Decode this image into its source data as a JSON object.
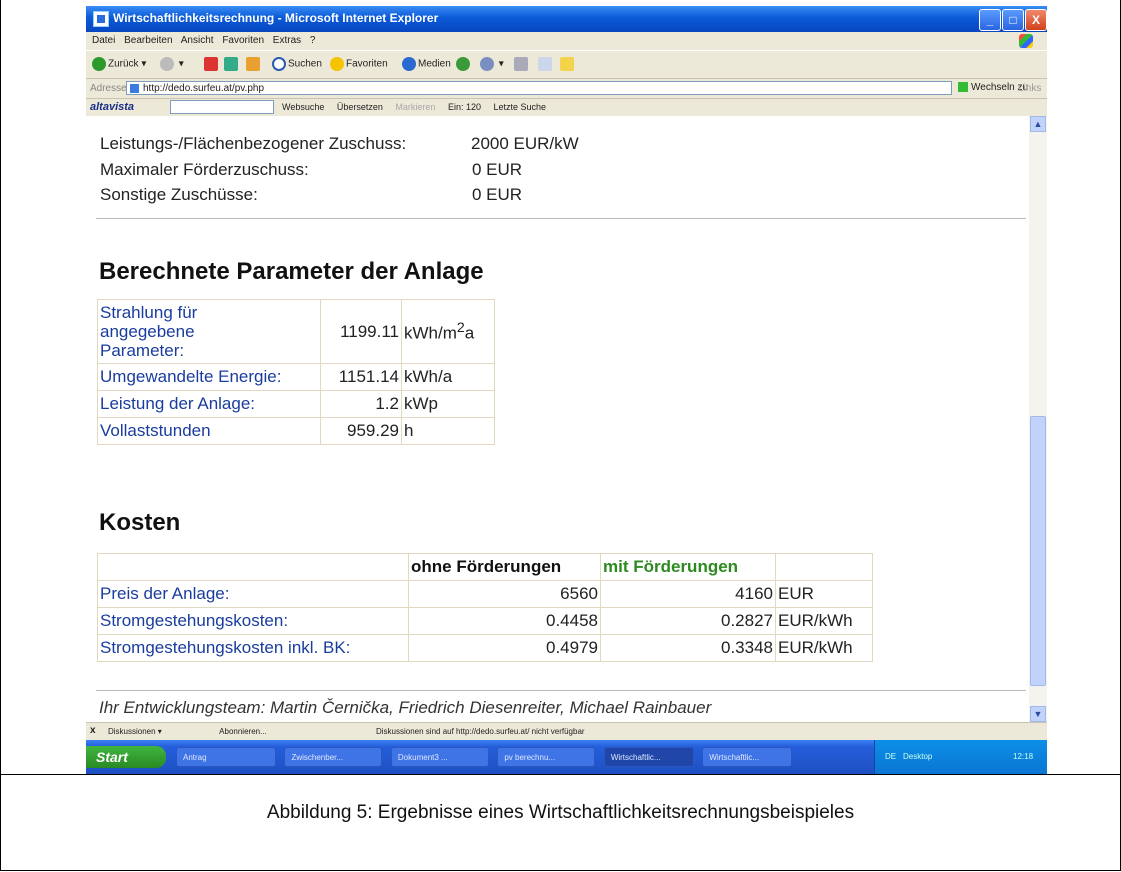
{
  "window": {
    "title": "Wirtschaftlichkeitsrechnung - Microsoft Internet Explorer",
    "min": "_",
    "max": "□",
    "close": "X"
  },
  "menu": [
    "Datei",
    "Bearbeiten",
    "Ansicht",
    "Favoriten",
    "Extras",
    "?"
  ],
  "toolbar": {
    "back": "Zurück",
    "search": "Suchen",
    "favorites": "Favoriten",
    "media": "Medien"
  },
  "address": {
    "label": "Adresse",
    "url": "http://dedo.surfeu.at/pv.php",
    "go": "Wechseln zu",
    "links": "Links"
  },
  "altavista": {
    "logo": "altavista",
    "items": [
      "Websuche",
      "Übersetzen",
      "Markieren",
      "Ein: 120",
      "Letzte Suche"
    ]
  },
  "subsidies": [
    {
      "label": "Leistungs-/Flächenbezogener Zuschuss:",
      "value": "2000 EUR/kW"
    },
    {
      "label": "Maximaler Förderzuschuss:",
      "value": "0 EUR"
    },
    {
      "label": "Sonstige Zuschüsse:",
      "value": "0 EUR"
    }
  ],
  "parameters": {
    "heading": "Berechnete Parameter der Anlage",
    "rows": [
      {
        "label_lines": [
          "Strahlung für",
          "angegebene",
          "Parameter:"
        ],
        "value": "1199.11",
        "unit_base": "kWh/m",
        "unit_sup": "2",
        "unit_tail": "a"
      },
      {
        "label": "Umgewandelte Energie:",
        "value": "1151.14",
        "unit": "kWh/a"
      },
      {
        "label": "Leistung der Anlage:",
        "value": "1.2",
        "unit": "kWp"
      },
      {
        "label": "Vollaststunden",
        "value": "959.29",
        "unit": "h"
      }
    ]
  },
  "costs": {
    "heading": "Kosten",
    "col_without": "ohne Förderungen",
    "col_with": "mit Förderungen",
    "rows": [
      {
        "label": "Preis der Anlage:",
        "without": "6560",
        "with": "4160",
        "unit": "EUR"
      },
      {
        "label": "Stromgestehungskosten:",
        "without": "0.4458",
        "with": "0.2827",
        "unit": "EUR/kWh"
      },
      {
        "label": "Stromgestehungskosten inkl. BK:",
        "without": "0.4979",
        "with": "0.3348",
        "unit": "EUR/kWh"
      }
    ]
  },
  "team": "Ihr Entwicklungsteam: Martin Černička, Friedrich Diesenreiter, Michael Rainbauer",
  "statusbar": {
    "close": "x",
    "discussions": "Diskussionen",
    "subscribe": "Abonnieren...",
    "message": "Diskussionen sind auf http://dedo.surfeu.at/ nicht verfügbar"
  },
  "taskbar": {
    "start": "Start",
    "tasks": [
      "Antrag",
      "Zwischenber...",
      "Dokument3 ...",
      "pv berechnu...",
      "Wirtschaftlic...",
      "Wirtschaftlic..."
    ],
    "lang": "DE",
    "desktop": "Desktop",
    "clock": "12:18"
  },
  "caption": "Abbildung 5: Ergebnisse eines Wirtschaftlichkeitsrechnungsbeispieles"
}
